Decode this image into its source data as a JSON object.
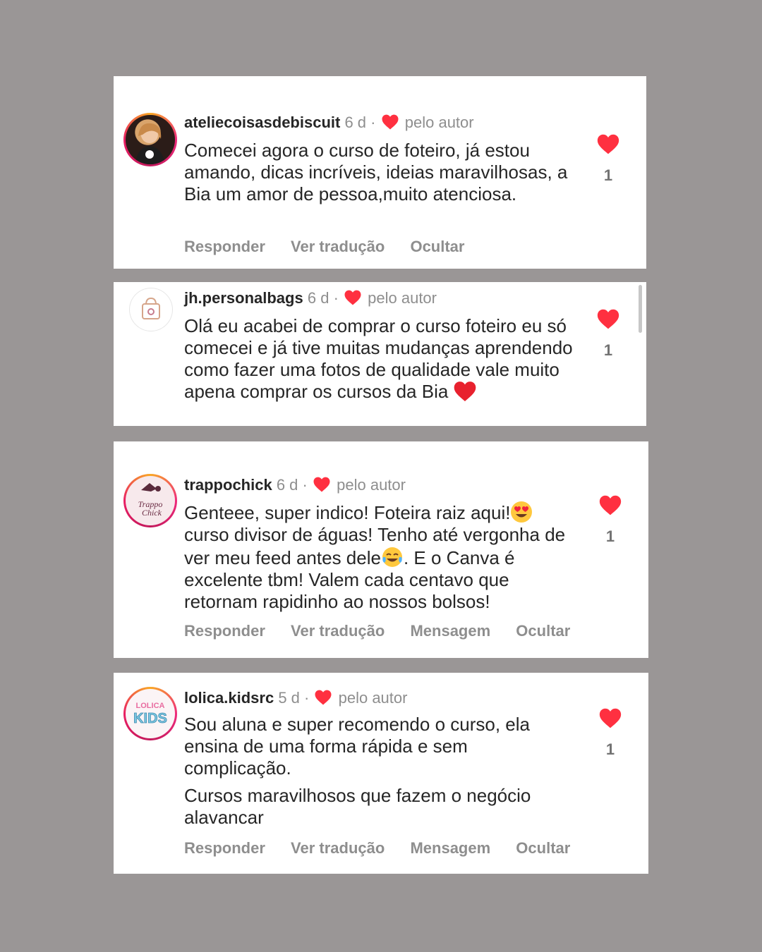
{
  "comments": [
    {
      "username": "ateliecoisasdebiscuit",
      "time": "6 d",
      "separator": "·",
      "author_label": "pelo autor",
      "text": "Comecei agora o curso de foteiro,  já estou amando, dicas incríveis, ideias maravilhosas, a Bia um amor de pessoa,muito atenciosa.",
      "likes": "1",
      "actions": [
        "Responder",
        "Ver tradução",
        "Ocultar"
      ],
      "avatar_icon": "profile-photo"
    },
    {
      "username": "jh.personalbags",
      "time": "6 d",
      "separator": "·",
      "author_label": "pelo autor",
      "text": "Olá eu acabei de comprar o curso foteiro eu só comecei e já tive muitas mudanças aprendendo como fazer uma fotos de qualidade vale muito apena comprar os cursos da Bia",
      "text_emoji": "red-heart",
      "likes": "1",
      "avatar_icon": "shopping-bag-logo"
    },
    {
      "username": "trappochick",
      "time": "6 d",
      "separator": "·",
      "author_label": "pelo autor",
      "text": "Genteee, super indico! Foteira raiz aqui!",
      "text_2": "curso divisor de águas! Tenho até vergonha de ver meu feed antes dele",
      "text_3": ". E o Canva é excelente tbm! Valem cada centavo que retornam rapidinho ao nossos bolsos!",
      "avatar_text": "Trappo Chick",
      "likes": "1",
      "actions": [
        "Responder",
        "Ver tradução",
        "Mensagem",
        "Ocultar"
      ]
    },
    {
      "username": "lolica.kidsrc",
      "time": "5 d",
      "separator": "·",
      "author_label": "pelo autor",
      "text": "Sou aluna e super recomendo o curso, ela ensina de uma forma rápida e sem complicação.",
      "text_2": "Cursos maravilhosos que fazem o negócio alavancar",
      "avatar_text_1": "LOLICA",
      "avatar_text_2": "KIDS",
      "likes": "1",
      "actions": [
        "Responder",
        "Ver tradução",
        "Mensagem",
        "Ocultar"
      ]
    }
  ],
  "colors": {
    "background": "#9a9696",
    "heart": "#ff3040",
    "text": "#262626",
    "muted": "#8e8e8e"
  }
}
